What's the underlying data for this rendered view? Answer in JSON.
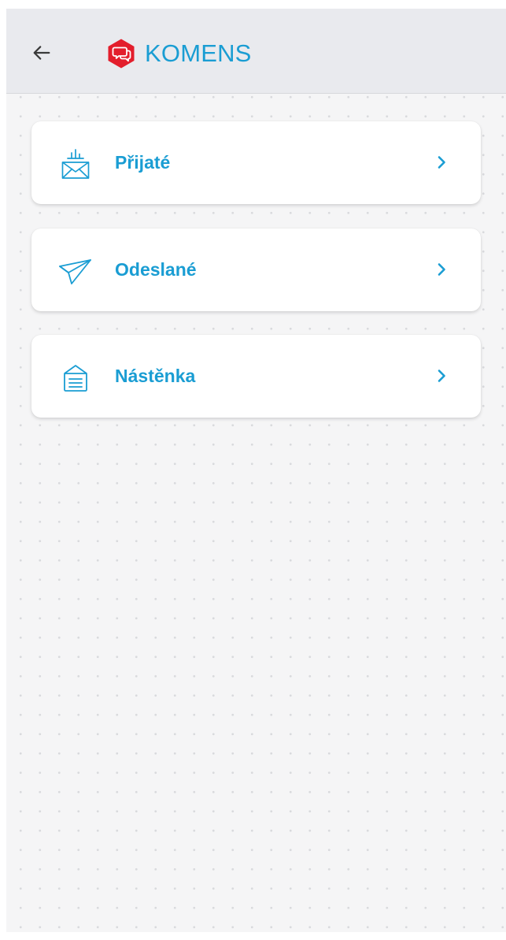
{
  "app": {
    "title": "KOMENS"
  },
  "colors": {
    "accent": "#1a9dd3",
    "logo": "#e31e2c",
    "appbar_background": "#e9eaee",
    "screen_background": "#f5f5f6"
  },
  "appbar": {
    "back_icon": "arrow-left-icon",
    "logo_icon": "chat-bubbles-hexagon-logo"
  },
  "menu": {
    "items": [
      {
        "label": "Přijaté",
        "icon": "inbox-envelope-icon"
      },
      {
        "label": "Odeslané",
        "icon": "paper-plane-icon"
      },
      {
        "label": "Nástěnka",
        "icon": "notice-board-icon"
      }
    ]
  }
}
